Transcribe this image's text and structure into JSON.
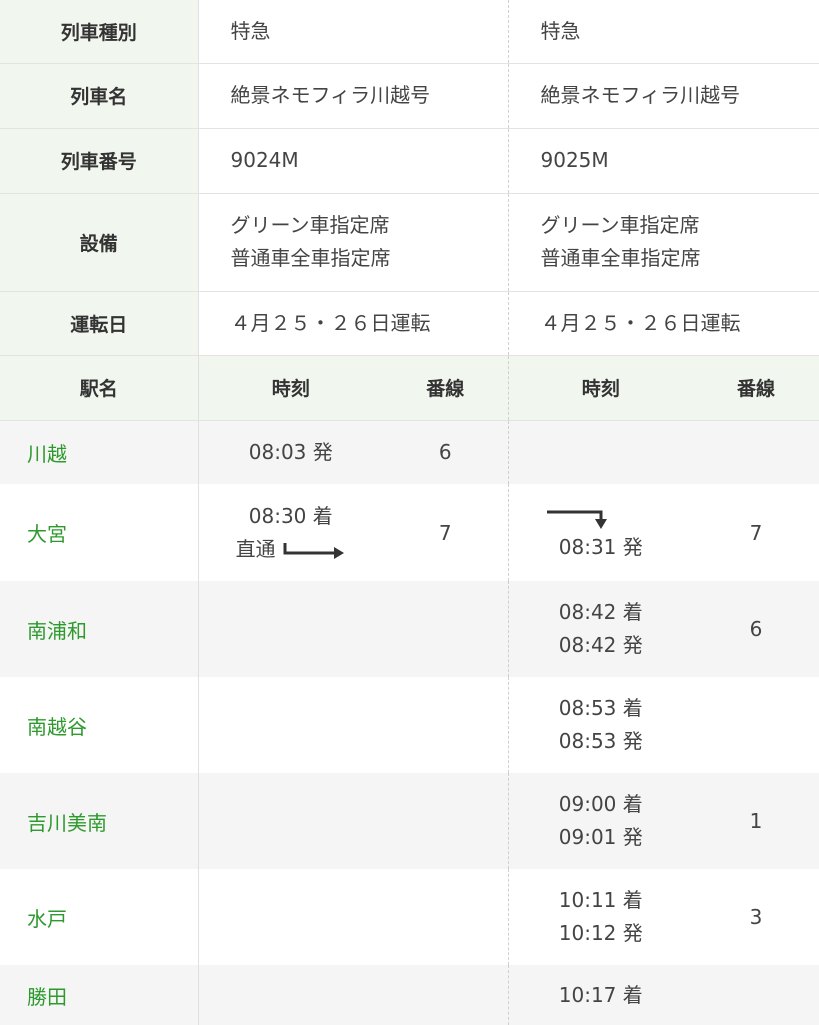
{
  "info_rows": [
    {
      "label": "列車種別",
      "t1": [
        "特急"
      ],
      "t2": [
        "特急"
      ]
    },
    {
      "label": "列車名",
      "t1": [
        "絶景ネモフィラ川越号"
      ],
      "t2": [
        "絶景ネモフィラ川越号"
      ]
    },
    {
      "label": "列車番号",
      "t1": [
        "9024M"
      ],
      "t2": [
        "9025M"
      ]
    },
    {
      "label": "設備",
      "t1": [
        "グリーン車指定席",
        "普通車全車指定席"
      ],
      "t2": [
        "グリーン車指定席",
        "普通車全車指定席"
      ]
    },
    {
      "label": "運転日",
      "t1": [
        "４月２５・２６日運転"
      ],
      "t2": [
        "４月２５・２６日運転"
      ]
    }
  ],
  "header": {
    "station": "駅名",
    "time1": "時刻",
    "plat1": "番線",
    "time2": "時刻",
    "plat2": "番線"
  },
  "stations": [
    {
      "name": "川越",
      "t1": [
        "08:03 発"
      ],
      "p1": "6",
      "t2": [],
      "p2": ""
    },
    {
      "name": "大宮",
      "t1": [
        "08:30 着"
      ],
      "through": "直通",
      "p1": "7",
      "t2": [
        "08:31 発"
      ],
      "p2": "7"
    },
    {
      "name": "南浦和",
      "t1": [],
      "p1": "",
      "t2": [
        "08:42 着",
        "08:42 発"
      ],
      "p2": "6"
    },
    {
      "name": "南越谷",
      "t1": [],
      "p1": "",
      "t2": [
        "08:53 着",
        "08:53 発"
      ],
      "p2": ""
    },
    {
      "name": "吉川美南",
      "t1": [],
      "p1": "",
      "t2": [
        "09:00 着",
        "09:01 発"
      ],
      "p2": "1"
    },
    {
      "name": "水戸",
      "t1": [],
      "p1": "",
      "t2": [
        "10:11 着",
        "10:12 発"
      ],
      "p2": "3"
    },
    {
      "name": "勝田",
      "t1": [],
      "p1": "",
      "t2": [
        "10:17 着"
      ],
      "p2": ""
    }
  ],
  "colors": {
    "label_bg": "#f1f7ef",
    "station_link": "#2e9a2e",
    "zebra_bg": "#f5f5f5"
  }
}
